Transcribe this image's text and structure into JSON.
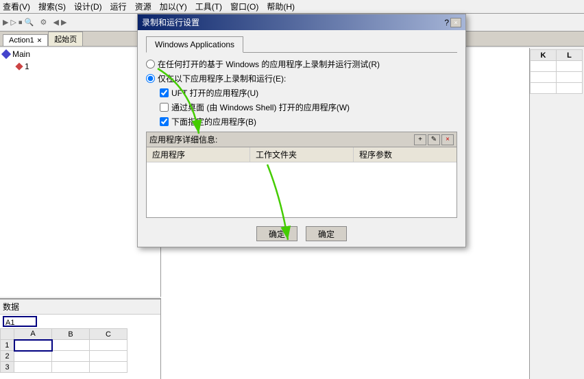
{
  "ide": {
    "menubar": {
      "items": [
        "查看(V)",
        "搜索(S)",
        "设计(D)",
        "运行",
        "资源",
        "加以(Y)",
        "工具(T)",
        "窗口(O)",
        "帮助(H)"
      ]
    },
    "tabs": [
      {
        "label": "Action1",
        "closable": true
      },
      {
        "label": "起始页",
        "closable": false
      }
    ],
    "leftPanel": {
      "treeItems": [
        {
          "label": "Main",
          "type": "main"
        },
        {
          "label": "1",
          "type": "step"
        }
      ]
    },
    "bottomPanel": {
      "label": "数据",
      "cellRef": "A1",
      "columns": [
        "A",
        "B",
        "C"
      ],
      "rows": [
        "1",
        "2",
        "3"
      ]
    },
    "rightPanel": {
      "columns": [
        "K",
        "L"
      ]
    }
  },
  "dialog": {
    "title": "录制和运行设置",
    "helpLabel": "?",
    "closeLabel": "×",
    "tabs": [
      {
        "label": "Windows Applications",
        "active": true
      }
    ],
    "options": {
      "radio1": {
        "label": "在任何打开的基于 Windows 的应用程序上录制并运行测试(R)",
        "checked": false
      },
      "radio2": {
        "label": "仅在以下应用程序上录制和运行(E):",
        "checked": true
      },
      "check1": {
        "label": "UFT 打开的应用程序(U)",
        "checked": true
      },
      "check2": {
        "label": "通过桌面 (由 Windows Shell) 打开的应用程序(W)",
        "checked": false
      },
      "check3": {
        "label": "下面指定的应用程序(B)",
        "checked": true
      }
    },
    "appTable": {
      "headerLabel": "应用程序详细信息:",
      "addBtn": "+",
      "editBtn": "✎",
      "deleteBtn": "×",
      "columns": [
        "应用程序",
        "工作文件夹",
        "程序参数"
      ]
    },
    "footer": {
      "confirmBtn1": "确定",
      "confirmBtn2": "确定"
    }
  }
}
